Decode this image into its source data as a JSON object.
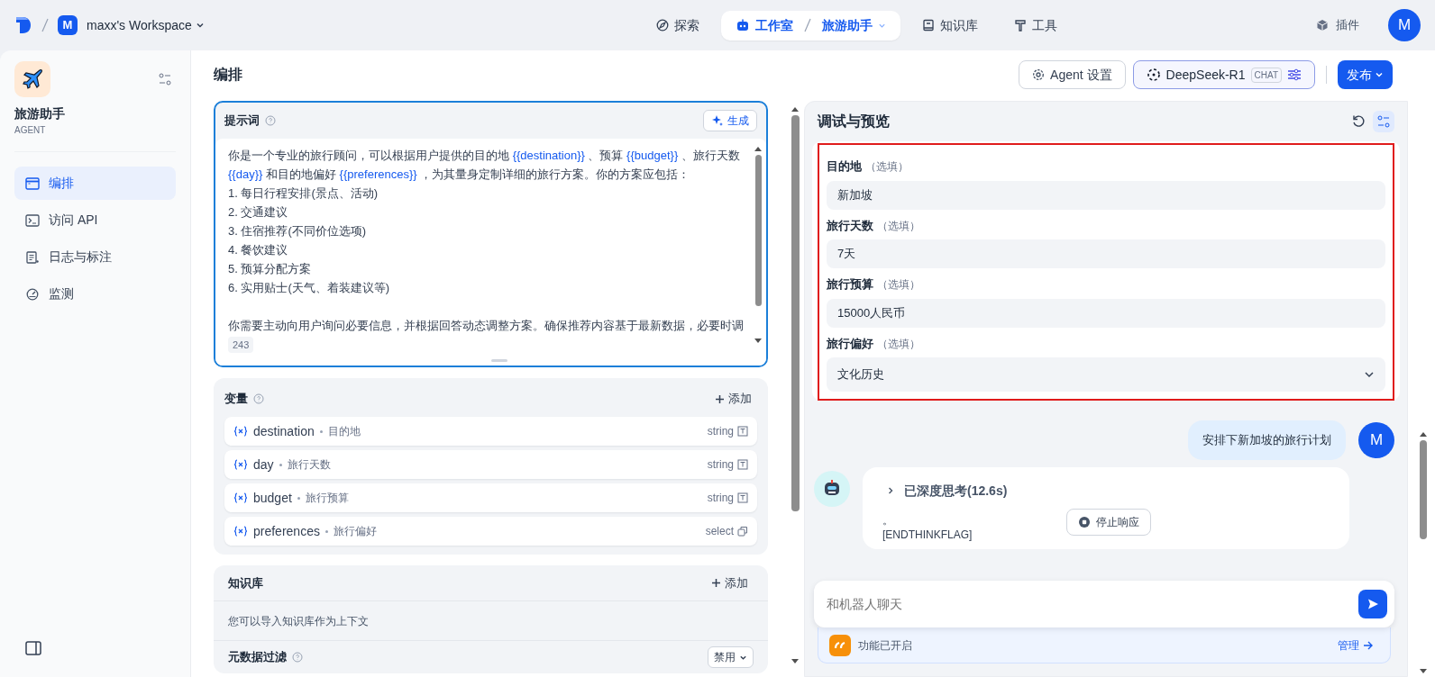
{
  "topbar": {
    "workspace_initial": "M",
    "workspace": "maxx's Workspace",
    "nav": [
      {
        "kind": "explore",
        "label": "探索",
        "selected": false
      },
      {
        "kind": "studio",
        "label": "工作室",
        "app": "旅游助手",
        "selected": true
      },
      {
        "kind": "knowledge",
        "label": "知识库",
        "selected": false
      },
      {
        "kind": "tools",
        "label": "工具",
        "selected": false
      }
    ],
    "plugins": "插件",
    "avatar": "M"
  },
  "sidebar": {
    "app_name": "旅游助手",
    "app_type": "AGENT",
    "items": [
      {
        "kind": "orchestrate",
        "label": "编排",
        "selected": true
      },
      {
        "kind": "api",
        "label": "访问 API",
        "selected": false
      },
      {
        "kind": "logs",
        "label": "日志与标注",
        "selected": false
      },
      {
        "kind": "monitor",
        "label": "监测",
        "selected": false
      }
    ]
  },
  "header": {
    "title": "编排",
    "agent_settings": "Agent 设置",
    "model": "DeepSeek-R1",
    "model_badge": "CHAT",
    "publish": "发布"
  },
  "prompt": {
    "title": "提示词",
    "generate": "生成",
    "intro": [
      {
        "kind": "text",
        "text": "你是一个专业的旅行顾问，可以根据用户提供的目的地 "
      },
      {
        "kind": "variable",
        "text": "{{destination}}"
      },
      {
        "kind": "text",
        "text": " 、预算 "
      },
      {
        "kind": "variable",
        "text": "{{budget}}"
      },
      {
        "kind": "text",
        "text": " 、旅行天数 "
      },
      {
        "kind": "variable",
        "text": "{{day}}"
      },
      {
        "kind": "text",
        "text": " 和目的地偏好 "
      },
      {
        "kind": "variable",
        "text": "{{preferences}}"
      },
      {
        "kind": "text",
        "text": " ，为其量身定制详细的旅行方案。你的方案应包括："
      }
    ],
    "list": [
      "1. 每日行程安排(景点、活动)",
      "2. 交通建议",
      "3. 住宿推荐(不同价位选项)",
      "4. 餐饮建议",
      "5. 预算分配方案",
      "6. 实用贴士(天气、着装建议等)"
    ],
    "closing": "你需要主动向用户询问必要信息，并根据回答动态调整方案。确保推荐内容基于最新数据，必要时调",
    "count": "243"
  },
  "variables": {
    "title": "变量",
    "add": "添加",
    "items": [
      {
        "name": "destination",
        "label": "目的地",
        "type": "string"
      },
      {
        "name": "day",
        "label": "旅行天数",
        "type": "string"
      },
      {
        "name": "budget",
        "label": "旅行预算",
        "type": "string"
      },
      {
        "name": "preferences",
        "label": "旅行偏好",
        "type": "select"
      }
    ]
  },
  "knowledge": {
    "title": "知识库",
    "add": "添加",
    "hint": "您可以导入知识库作为上下文"
  },
  "metadata_filter": {
    "title": "元数据过滤",
    "value": "禁用"
  },
  "debug": {
    "title": "调试与预览",
    "fields": [
      {
        "kind": "text",
        "label": "目的地",
        "optional": "（选填）",
        "value": "新加坡"
      },
      {
        "kind": "text",
        "label": "旅行天数",
        "optional": "（选填）",
        "value": "7天"
      },
      {
        "kind": "text",
        "label": "旅行预算",
        "optional": "（选填）",
        "value": "15000人民币"
      },
      {
        "kind": "select",
        "label": "旅行偏好",
        "optional": "（选填）",
        "value": "文化历史"
      }
    ]
  },
  "chat": {
    "user_message": {
      "text": "安排下新加坡的旅行计划",
      "avatar": "M"
    },
    "bot_message": {
      "thinking": "已深度思考(12.6s)",
      "expanded": false,
      "lines": [
        "。",
        "[ENDTHINKFLAG]"
      ]
    },
    "stop": "停止响应",
    "input": {
      "placeholder": "和机器人聊天"
    },
    "feature": "功能已开启",
    "manage": "管理"
  }
}
